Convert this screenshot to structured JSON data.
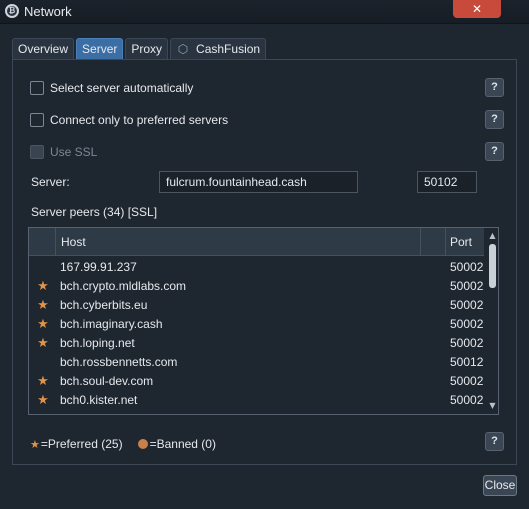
{
  "window": {
    "title": "Network",
    "close_symbol": "✕"
  },
  "tabs": [
    {
      "label": "Overview",
      "active": false
    },
    {
      "label": "Server",
      "active": true
    },
    {
      "label": "Proxy",
      "active": false
    },
    {
      "label": "CashFusion",
      "active": false
    }
  ],
  "options": {
    "auto_select_label": "Select server automatically",
    "preferred_only_label": "Connect only to preferred servers",
    "use_ssl_label": "Use SSL",
    "help_label": "?"
  },
  "server": {
    "label": "Server:",
    "host_value": "fulcrum.fountainhead.cash",
    "port_value": "50102"
  },
  "peers": {
    "label": "Server peers (34)  [SSL]",
    "columns": {
      "host": "Host",
      "port": "Port"
    },
    "rows": [
      {
        "host": "167.99.91.237",
        "port": "50002",
        "preferred": false
      },
      {
        "host": "bch.crypto.mldlabs.com",
        "port": "50002",
        "preferred": true
      },
      {
        "host": "bch.cyberbits.eu",
        "port": "50002",
        "preferred": true
      },
      {
        "host": "bch.imaginary.cash",
        "port": "50002",
        "preferred": true
      },
      {
        "host": "bch.loping.net",
        "port": "50002",
        "preferred": true
      },
      {
        "host": "bch.rossbennetts.com",
        "port": "50012",
        "preferred": false
      },
      {
        "host": "bch.soul-dev.com",
        "port": "50002",
        "preferred": true
      },
      {
        "host": "bch0.kister.net",
        "port": "50002",
        "preferred": true
      }
    ]
  },
  "legend": {
    "preferred_text": "=Preferred (25)",
    "banned_text": "=Banned (0)"
  },
  "buttons": {
    "close_label": "Close"
  },
  "colors": {
    "accent": "#3a6ea5",
    "star": "#e0934a",
    "background": "#1e2630"
  }
}
